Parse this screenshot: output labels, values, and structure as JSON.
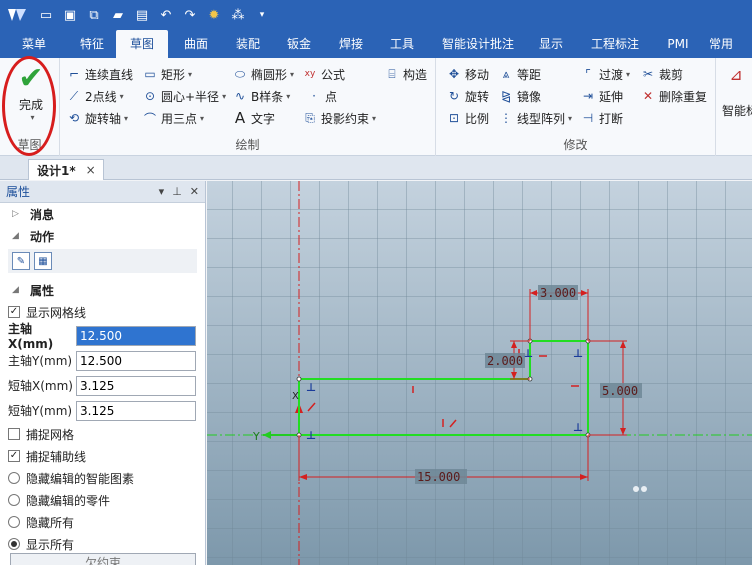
{
  "menu_tabs": [
    "菜单",
    "特征",
    "草图",
    "曲面",
    "装配",
    "钣金",
    "焊接",
    "工具",
    "智能设计批注",
    "显示",
    "工程标注",
    "PMI",
    "常用"
  ],
  "active_tab": "草图",
  "ribbon": {
    "finish_label": "完成",
    "group_sketch": "草图",
    "group_draw": "绘制",
    "group_modify": "修改",
    "draw_items": {
      "polyline": "连续直线",
      "rect": "矩形",
      "ellipse": "椭圆形",
      "formula": "公式",
      "construct": "构造",
      "two_point": "2点线",
      "circle_center_radius": "圆心+半径",
      "bspline": "B样条",
      "point": "点",
      "rotate_axis": "旋转轴",
      "three_point": "用三点",
      "text": "文字",
      "project_constraint": "投影约束"
    },
    "modify_items": {
      "move": "移动",
      "offset": "等距",
      "fillet": "过渡",
      "trim": "裁剪",
      "rotate": "旋转",
      "mirror": "镜像",
      "extend": "延伸",
      "delete_dup": "删除重复",
      "scale": "比例",
      "linear_array": "线型阵列",
      "break": "打断"
    },
    "smart_label": "智能标"
  },
  "document_tab": {
    "title": "设计1*",
    "close": "×"
  },
  "panel": {
    "title": "属性",
    "section_messages": "消息",
    "section_actions": "动作",
    "section_properties": "属性",
    "show_grid_label": "显示网格线",
    "show_grid_checked": true,
    "major_x_label": "主轴X(mm)",
    "major_x_value": "12.500",
    "major_y_label": "主轴Y(mm)",
    "major_y_value": "12.500",
    "minor_x_label": "短轴X(mm)",
    "minor_x_value": "3.125",
    "minor_y_label": "短轴Y(mm)",
    "minor_y_value": "3.125",
    "snap_grid_label": "捕捉网格",
    "snap_grid_checked": false,
    "snap_aux_label": "捕捉辅助线",
    "snap_aux_checked": true,
    "hide_smart_label": "隐藏编辑的智能图素",
    "hide_parts_label": "隐藏编辑的零件",
    "hide_all_label": "隐藏所有",
    "show_all_label": "显示所有",
    "bottom_button": "欠约束"
  },
  "canvas": {
    "dims": {
      "top_width": "3.000",
      "left_height": "2.000",
      "right_height": "5.000",
      "bottom_width": "15.000"
    },
    "axis_y_label": "Y"
  },
  "colors": {
    "titlebar": "#2b63b6",
    "canvas_top": "#c2d0dc",
    "canvas_bottom": "#7f99ac",
    "sketch_line": "#22dd22",
    "dimension": "#d42020",
    "finish_highlight": "#d71d1d"
  }
}
